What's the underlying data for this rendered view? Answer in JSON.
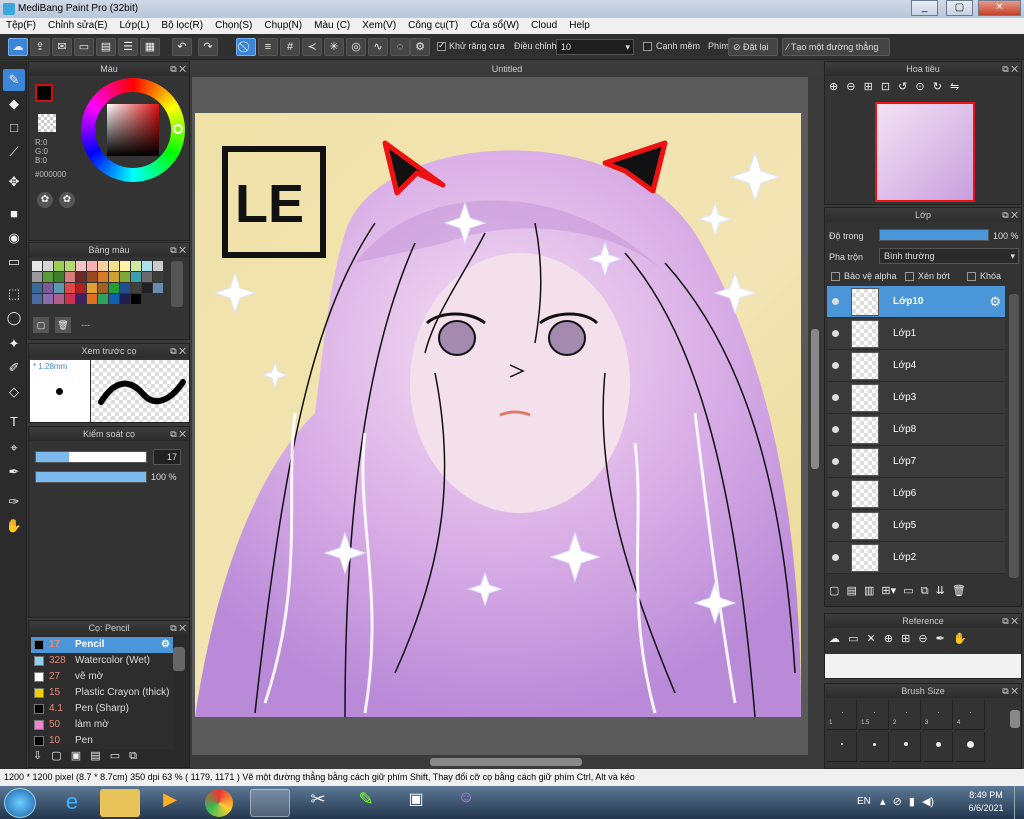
{
  "window": {
    "title": "MediBang Paint Pro (32bit)",
    "min": "_",
    "max": "▢",
    "close": "✕"
  },
  "menu": [
    "Tệp(F)",
    "Chỉnh sửa(E)",
    "Lớp(L)",
    "Bộ lọc(R)",
    "Chọn(S)",
    "Chụp(N)",
    "Màu (C)",
    "Xem(V)",
    "Công cụ(T)",
    "Cửa sổ(W)",
    "Cloud",
    "Help"
  ],
  "toolbar": {
    "antialias_label": "Khử răng cưa",
    "antialias_checked": true,
    "adjust_label": "Điều chỉnh",
    "adjust_value": "10",
    "soft_edge_label": "Cạnh mềm",
    "soft_edge_checked": false,
    "key_label": "Phím",
    "reset_label": "Đặt lại",
    "straight_line_label": "Tạo một đường thẳng"
  },
  "panels": {
    "color": {
      "title": "Màu",
      "rgb": [
        "R:0",
        "G:0",
        "B:0"
      ],
      "hex": "#000000",
      "fg": "#000000",
      "bg": "#cc1111"
    },
    "swatches": {
      "title": "Bảng màu",
      "more": "---",
      "colors": [
        "#e7e7e7",
        "#d4d4d4",
        "#9bcc54",
        "#b8d86e",
        "#f4c2c2",
        "#f4b0b0",
        "#f8d0a0",
        "#f4e088",
        "#fff3a8",
        "#d0e8a0",
        "#a8e0f0",
        "#cbcbcb",
        "#9a9a9a",
        "#5c9a3a",
        "#3f7f2b",
        "#d97c7c",
        "#6c2b2b",
        "#9a4a20",
        "#d87b28",
        "#d0a030",
        "#7fa838",
        "#3aa0b0",
        "#6a6a6a",
        "#3c3c3c",
        "#3a6a9a",
        "#7a5a9a",
        "#5a9ab0",
        "#e04848",
        "#b02020",
        "#e0a030",
        "#a06020",
        "#20a030",
        "#205090",
        "#404040",
        "#202020",
        "#6a8ab0",
        "#4a6aa0",
        "#8a6ab0",
        "#b0608a",
        "#d03050",
        "#402060",
        "#e07020",
        "#30a060",
        "#1060b0",
        "#202050",
        "#000000"
      ]
    },
    "brush_preview": {
      "title": "Xem trước cọ",
      "size": "1.28mm"
    },
    "brush_control": {
      "title": "Kiểm soát cọ",
      "size_value": "17",
      "opacity_value": "100 %",
      "size_fraction": 0.3,
      "opacity_fraction": 1.0
    },
    "brushes": {
      "title": "Cọ: Pencil",
      "items": [
        {
          "size": "17",
          "name": "Pencil",
          "color": "#000000",
          "selected": true
        },
        {
          "size": "328",
          "name": "Watercolor (Wet)",
          "color": "#8fd3f0",
          "selected": false
        },
        {
          "size": "27",
          "name": "vẽ mờ",
          "color": "#ffffff",
          "selected": false
        },
        {
          "size": "15",
          "name": "Plastic Crayon (thick)",
          "color": "#f0d000",
          "selected": false
        },
        {
          "size": "4.1",
          "name": "Pen (Sharp)",
          "color": "#000000",
          "selected": false
        },
        {
          "size": "50",
          "name": "làm mờ",
          "color": "#f080d0",
          "selected": false
        },
        {
          "size": "10",
          "name": "Pen",
          "color": "#000000",
          "selected": false
        }
      ]
    },
    "navigator": {
      "title": "Hoa tiêu"
    },
    "layers": {
      "title": "Lớp",
      "opacity_label": "Độ trong",
      "opacity_value": "100 %",
      "opacity_fraction": 1.0,
      "blend_label": "Pha trộn",
      "blend_value": "Bình thường",
      "protect_alpha": "Bảo vệ alpha",
      "clipping": "Xén bớt",
      "lock": "Khóa",
      "items": [
        {
          "name": "Lớp10",
          "selected": true
        },
        {
          "name": "Lớp1",
          "selected": false
        },
        {
          "name": "Lớp4",
          "selected": false
        },
        {
          "name": "Lớp3",
          "selected": false
        },
        {
          "name": "Lớp8",
          "selected": false
        },
        {
          "name": "Lớp7",
          "selected": false
        },
        {
          "name": "Lớp6",
          "selected": false
        },
        {
          "name": "Lớp5",
          "selected": false
        },
        {
          "name": "Lớp2",
          "selected": false
        }
      ]
    },
    "reference": {
      "title": "Reference"
    },
    "brush_size": {
      "title": "Brush Size",
      "row1": [
        "",
        "",
        "",
        "",
        ""
      ],
      "row2": [
        "1",
        "1.5",
        "2",
        "3",
        "4"
      ]
    }
  },
  "document": {
    "tab": "Untitled",
    "logo_text": "LE"
  },
  "status": {
    "text": "1200 * 1200 pixel   (8.7 * 8.7cm)   350 dpi   63 %   ( 1179, 1171 )   Vẽ một đường thẳng bằng cách giữ phím Shift, Thay đổi cỡ cọ bằng cách giữ phím Ctrl, Alt và kéo"
  },
  "taskbar": {
    "lang": "EN",
    "time": "8:49 PM",
    "date": "6/6/2021"
  }
}
